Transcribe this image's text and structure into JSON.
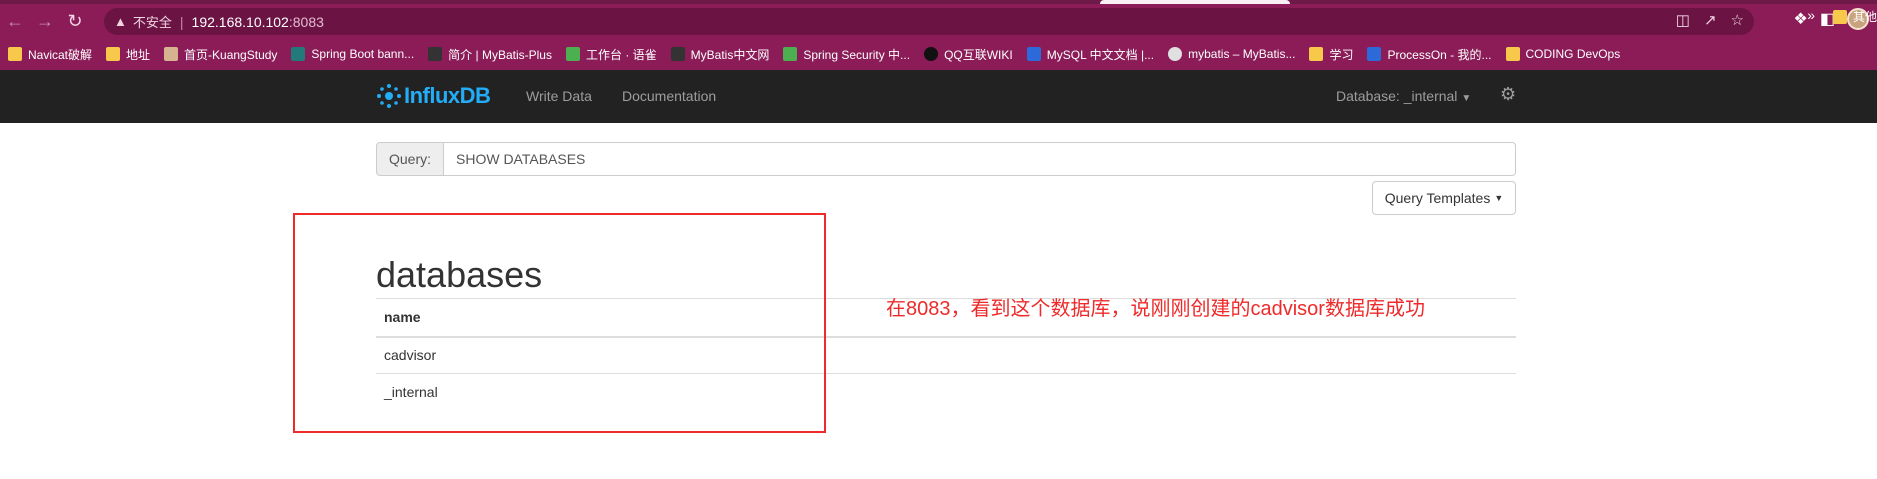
{
  "browser": {
    "url_warning_label": "不安全",
    "url_host": "192.168.10.102",
    "url_port": ":8083",
    "bookmarks": [
      {
        "label": "Navicat破解",
        "icon": "folder"
      },
      {
        "label": "地址",
        "icon": "folder"
      },
      {
        "label": "首页-KuangStudy",
        "icon": "img"
      },
      {
        "label": "Spring Boot bann...",
        "icon": "teal"
      },
      {
        "label": "简介 | MyBatis-Plus",
        "icon": "dark"
      },
      {
        "label": "工作台 · 语雀",
        "icon": "green"
      },
      {
        "label": "MyBatis中文网",
        "icon": "dark"
      },
      {
        "label": "Spring Security 中...",
        "icon": "green"
      },
      {
        "label": "QQ互联WIKI",
        "icon": "penguin"
      },
      {
        "label": "MySQL 中文文档 |...",
        "icon": "blue"
      },
      {
        "label": "mybatis – MyBatis...",
        "icon": "globe"
      },
      {
        "label": "学习",
        "icon": "folder"
      },
      {
        "label": "ProcessOn - 我的...",
        "icon": "blue"
      },
      {
        "label": "CODING DevOps",
        "icon": "folder"
      }
    ],
    "bookmarks_more": "»",
    "bookmarks_other": "其他"
  },
  "app": {
    "brand": "InfluxDB",
    "nav": {
      "write_data": "Write Data",
      "documentation": "Documentation",
      "database_label": "Database: _internal"
    },
    "query": {
      "addon_label": "Query:",
      "value": "SHOW DATABASES"
    },
    "templates_label": "Query Templates",
    "results": {
      "title": "databases",
      "column": "name",
      "rows": [
        "cadvisor",
        "_internal"
      ]
    }
  },
  "annotation": {
    "text": "在8083，看到这个数据库，说刚刚创建的cadvisor数据库成功",
    "color": "#ee2a2a"
  },
  "colors": {
    "browser_frame": "#8b1c58",
    "navbar": "#222222",
    "brand": "#22adf6"
  }
}
